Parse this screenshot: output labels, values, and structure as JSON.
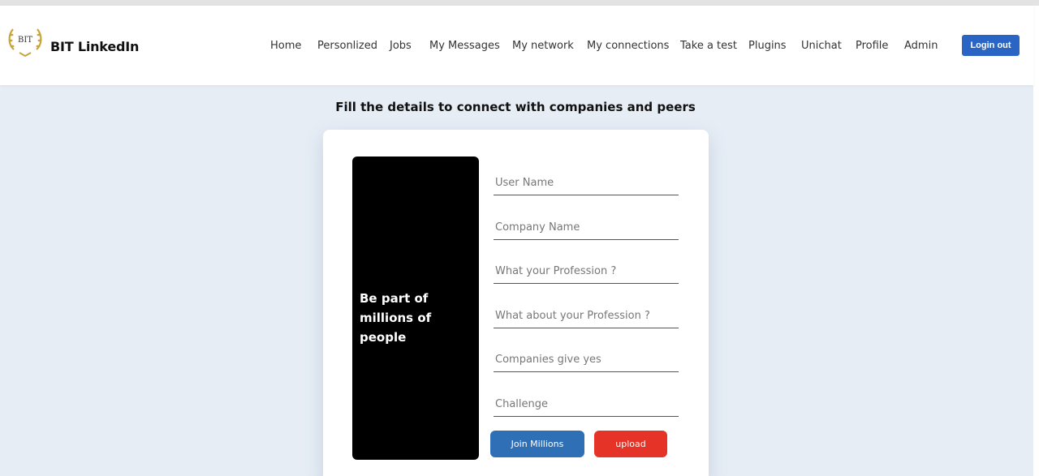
{
  "brand": {
    "name": "BIT LinkedIn",
    "logo_text": "BIT"
  },
  "nav": [
    "Home",
    "Personlized",
    "Jobs",
    "My Messages",
    "My network",
    "My connections",
    "Take a test",
    "Plugins",
    "Unichat",
    "Profile",
    "Admin"
  ],
  "login_button": "Login out",
  "heading": "Fill the details to connect with companies and peers",
  "panel_text": "Be part of millions of people",
  "form": {
    "user_name": "User Name",
    "company_name": "Company Name",
    "profession": "What your Profession ?",
    "about_profession": "What about your Profession ?",
    "companies_give_yes": "Companies give yes",
    "challenge": "Challenge"
  },
  "buttons": {
    "join": "Join Millions",
    "upload": "upload"
  },
  "colors": {
    "primary": "#2a64c4",
    "join": "#2f6fb5",
    "upload": "#e53427",
    "background": "#e6edf5"
  }
}
